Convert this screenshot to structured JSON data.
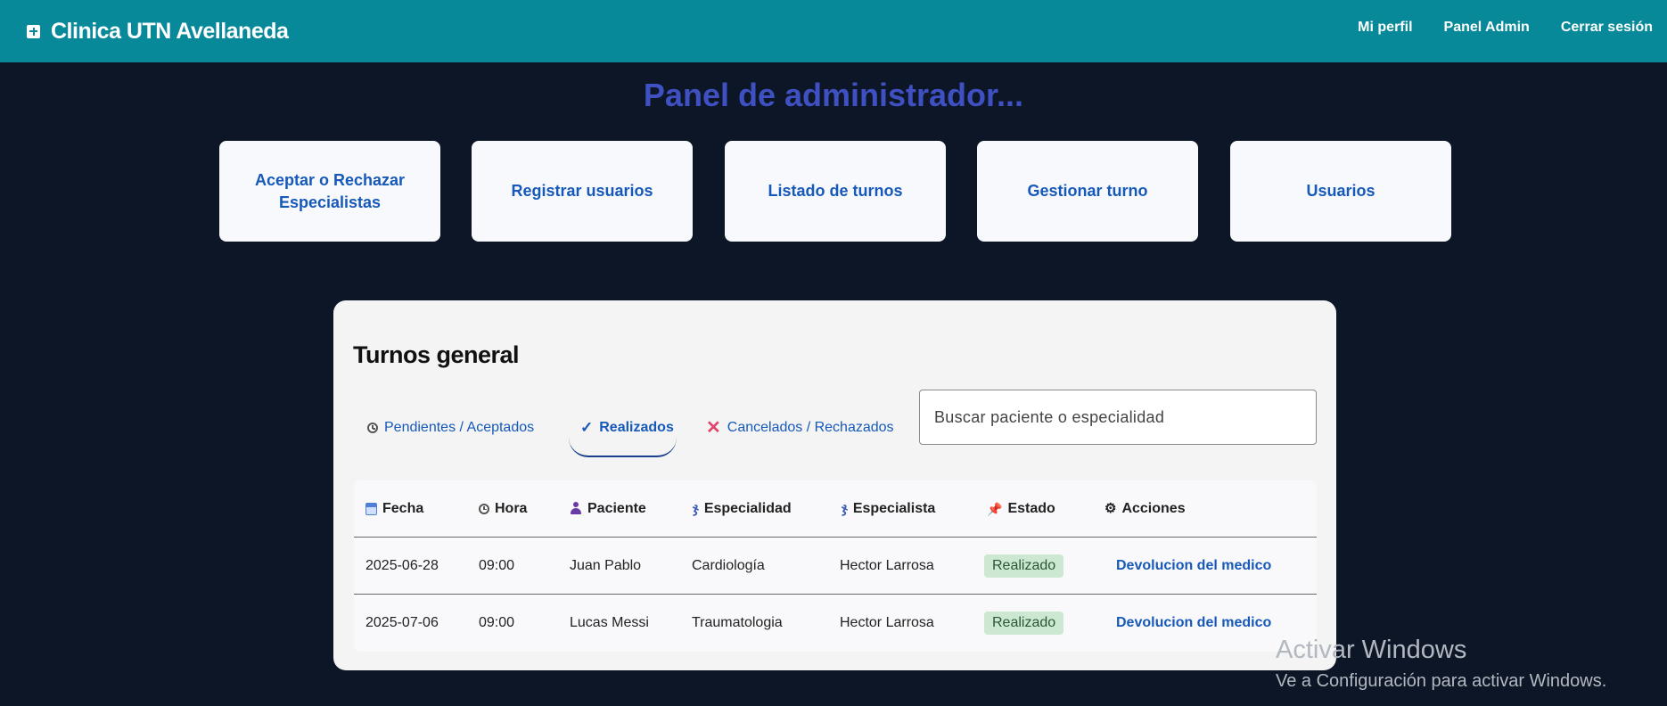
{
  "header": {
    "title": "Clinica UTN Avellaneda",
    "nav": [
      "Mi perfil",
      "Panel Admin",
      "Cerrar sesión"
    ]
  },
  "page_title": "Panel de administrador...",
  "cards": [
    "Aceptar o Rechazar Especialistas",
    "Registrar usuarios",
    "Listado de turnos",
    "Gestionar turno",
    "Usuarios"
  ],
  "panel": {
    "title": "Turnos general",
    "tabs": [
      {
        "label": "Pendientes / Aceptados",
        "icon": "clock-icon",
        "active": false
      },
      {
        "label": "Realizados",
        "icon": "check-icon",
        "active": true
      },
      {
        "label": "Cancelados / Rechazados",
        "icon": "x-icon",
        "active": false
      }
    ],
    "search_placeholder": "Buscar paciente o especialidad",
    "columns": [
      {
        "label": "Fecha",
        "icon": "calendar-icon"
      },
      {
        "label": "Hora",
        "icon": "clock-icon"
      },
      {
        "label": "Paciente",
        "icon": "person-icon"
      },
      {
        "label": "Especialidad",
        "icon": "stethoscope-icon"
      },
      {
        "label": "Especialista",
        "icon": "stethoscope-icon"
      },
      {
        "label": "Estado",
        "icon": "pushpin-icon"
      },
      {
        "label": "Acciones",
        "icon": "gear-icon"
      }
    ],
    "rows": [
      {
        "fecha": "2025-06-28",
        "hora": "09:00",
        "paciente": "Juan Pablo",
        "especialidad": "Cardiología",
        "especialista": "Hector Larrosa",
        "estado": "Realizado",
        "accion": "Devolucion del medico"
      },
      {
        "fecha": "2025-07-06",
        "hora": "09:00",
        "paciente": "Lucas Messi",
        "especialidad": "Traumatologia",
        "especialista": "Hector Larrosa",
        "estado": "Realizado",
        "accion": "Devolucion del medico"
      }
    ]
  },
  "watermark": {
    "title": "Activar Windows",
    "subtitle": "Ve a Configuración para activar Windows."
  },
  "colors": {
    "header_bg": "#07899a",
    "page_bg": "#0c1627",
    "accent": "#1659b8",
    "title": "#3f51c2",
    "badge_bg": "#cde8d2"
  }
}
